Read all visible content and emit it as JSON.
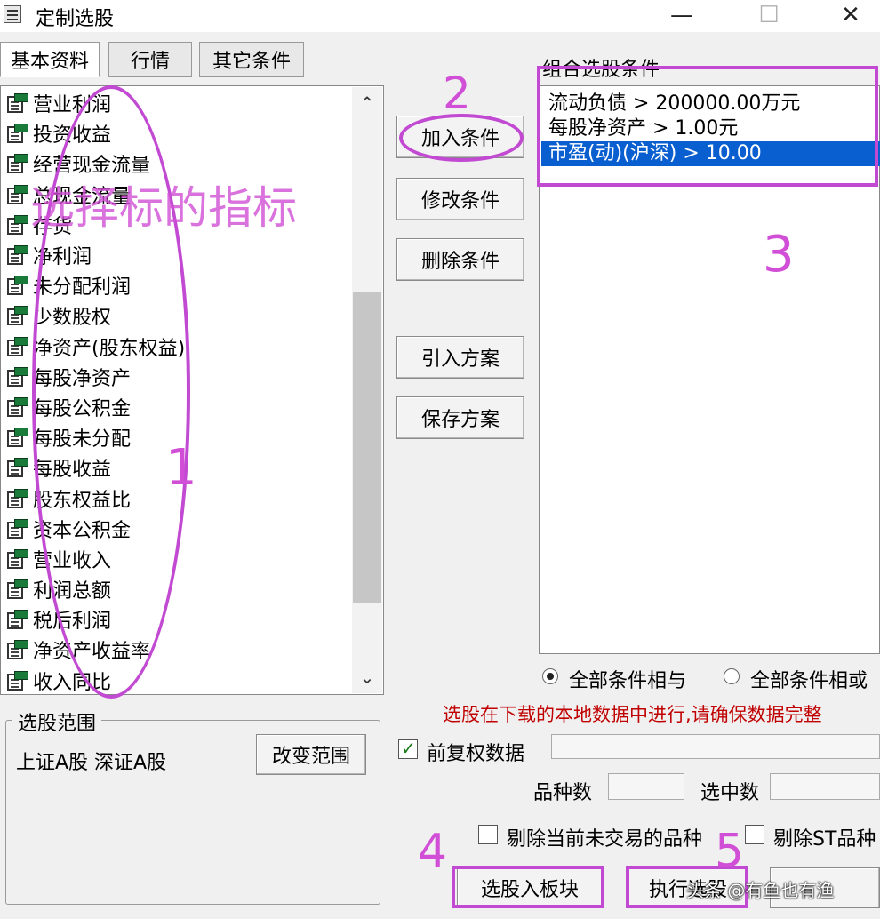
{
  "window": {
    "title": "定制选股",
    "minimize": "—",
    "maximize": "☐",
    "close": "✕"
  },
  "tabs": [
    "基本资料",
    "行情",
    "其它条件"
  ],
  "indicators": [
    "营业利润",
    "投资收益",
    "经营现金流量",
    "总现金流量",
    "存货",
    "净利润",
    "未分配利润",
    "少数股权",
    "净资产(股东权益)",
    "每股净资产",
    "每股公积金",
    "每股未分配",
    "每股收益",
    "股东权益比",
    "资本公积金",
    "营业收入",
    "利润总额",
    "税后利润",
    "净资产收益率",
    "收入同比"
  ],
  "scroll": {
    "up": "⌃",
    "down": "⌄"
  },
  "buttons": {
    "add": "加入条件",
    "modify": "修改条件",
    "delete": "删除条件",
    "import": "引入方案",
    "save": "保存方案",
    "change_range": "改变范围",
    "to_block": "选股入板块",
    "execute": "执行选股"
  },
  "conditions": {
    "label": "组合选股条件",
    "items": [
      "流动负债 > 200000.00万元",
      "每股净资产 > 1.00元",
      "市盈(动)(沪深) > 10.00"
    ],
    "selected_index": 2
  },
  "logic": {
    "and": "全部条件相与",
    "or": "全部条件相或",
    "selected": "and"
  },
  "warning": "选股在下载的本地数据中进行,请确保数据完整",
  "range": {
    "title": "选股范围",
    "value": "上证A股  深证A股"
  },
  "options": {
    "prev_adjust": "前复权数据",
    "prev_adjust_checked": true,
    "exclude_untraded": "剔除当前未交易的品种",
    "exclude_st": "剔除ST品种"
  },
  "counts": {
    "variety_label": "品种数",
    "selected_label": "选中数"
  },
  "annotations": {
    "left_note": "选择标的指标",
    "n1": "1",
    "n2": "2",
    "n3": "3",
    "n4": "4",
    "n5": "5",
    "watermark": "头条 @有鱼也有渔",
    "color": "#c24ad2"
  },
  "colors": {
    "selection": "#0a5fd0",
    "warning": "#c00000"
  }
}
